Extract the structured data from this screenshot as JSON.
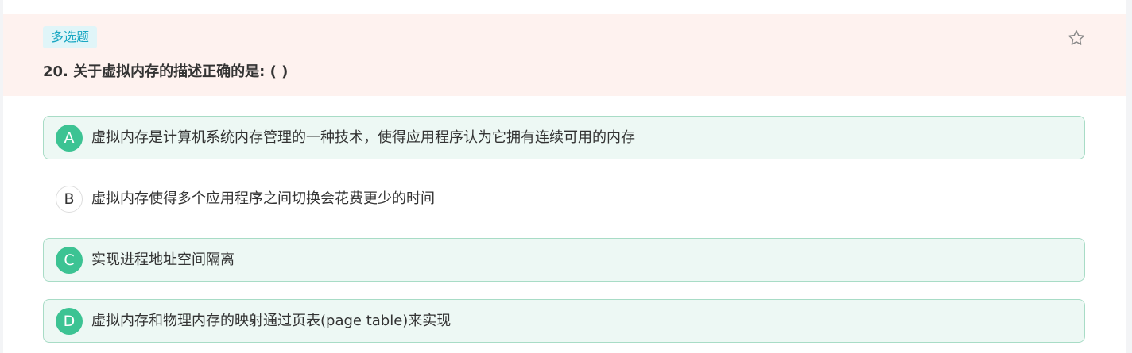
{
  "question": {
    "type_label": "多选题",
    "title": "20. 关于虚拟内存的描述正确的是: ( )",
    "star_icon": "star-outline-icon"
  },
  "options": [
    {
      "letter": "A",
      "text": "虚拟内存是计算机系统内存管理的一种技术，使得应用程序认为它拥有连续可用的内存",
      "selected": true
    },
    {
      "letter": "B",
      "text": "虚拟内存使得多个应用程序之间切换会花费更少的时间",
      "selected": false
    },
    {
      "letter": "C",
      "text": "实现进程地址空间隔离",
      "selected": true
    },
    {
      "letter": "D",
      "text": "虚拟内存和物理内存的映射通过页表(page table)来实现",
      "selected": true
    }
  ],
  "colors": {
    "header_bg": "#fef2ef",
    "badge_bg": "#e0f5f8",
    "badge_text": "#1aa7c2",
    "selected_bg": "#edf8f4",
    "selected_border": "#a8dcc6",
    "selected_circle": "#3cc393"
  }
}
